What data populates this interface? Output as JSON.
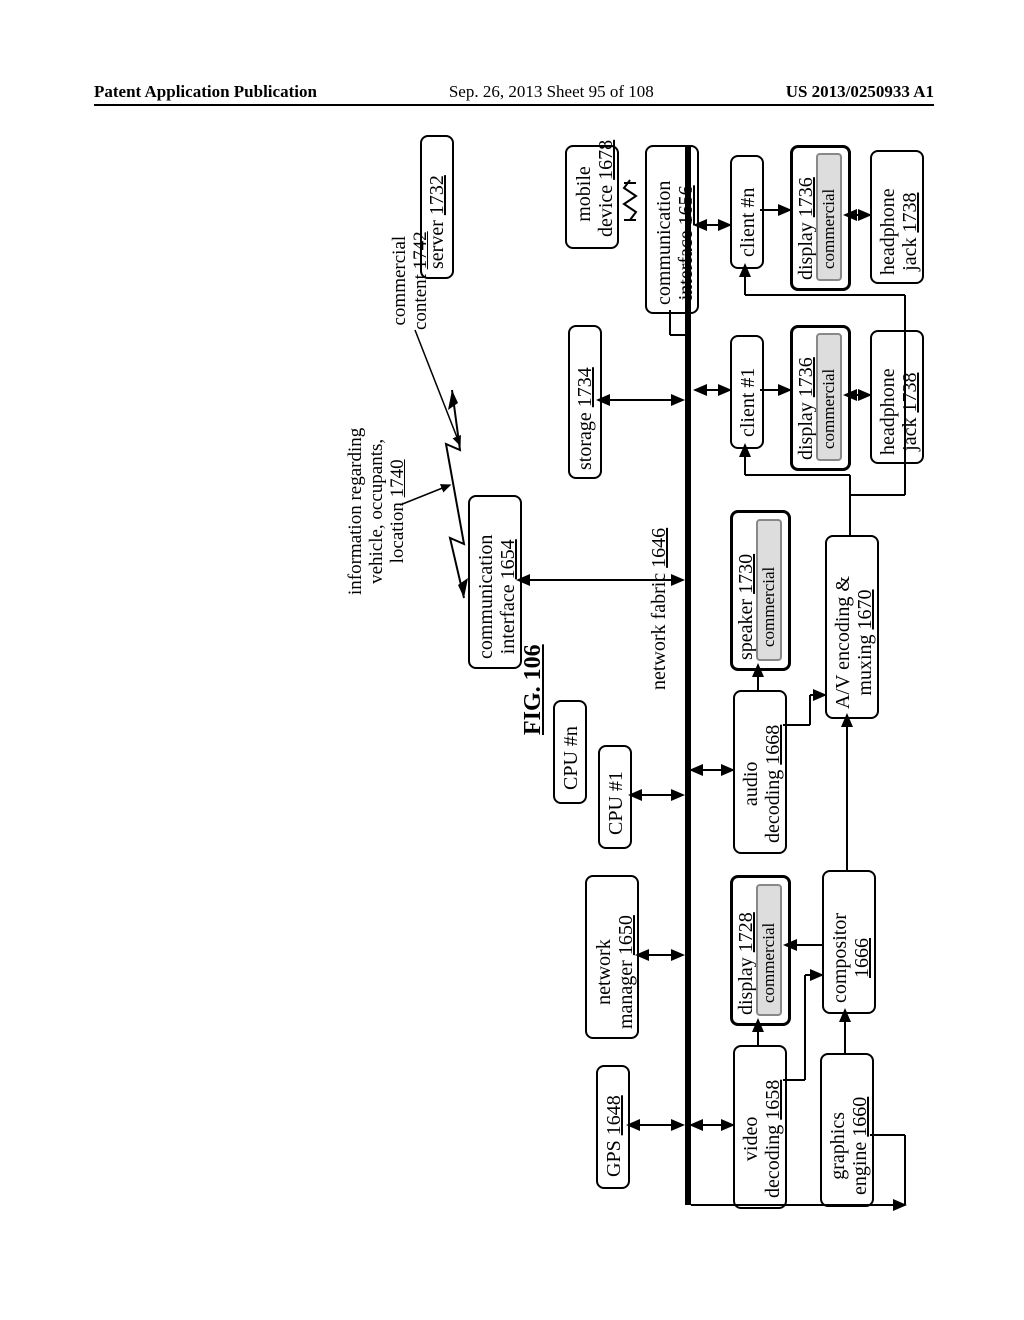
{
  "header": {
    "left": "Patent Application Publication",
    "mid": "Sep. 26, 2013  Sheet 95 of 108",
    "right": "US 2013/0250933 A1"
  },
  "figure": {
    "label": "FIG. 106"
  },
  "blocks": {
    "server": {
      "l1": "server",
      "ref": "1732"
    },
    "info": {
      "l1": "information regarding",
      "l2": "vehicle, occupants,",
      "l3": "location",
      "ref": "1740"
    },
    "commercial_content": {
      "l1": "commercial",
      "l2": "content",
      "ref": "1742"
    },
    "mobile": {
      "l1": "mobile",
      "l2": "device",
      "ref": "1678"
    },
    "comm2": {
      "l1": "communication",
      "l2": "interface",
      "ref": "1656"
    },
    "storage": {
      "l1": "storage",
      "ref": "1734"
    },
    "comm1": {
      "l1": "communication",
      "l2": "interface",
      "ref": "1654"
    },
    "cpun": {
      "l1": "CPU #n"
    },
    "cpu1": {
      "l1": "CPU #1"
    },
    "netmgr": {
      "l1": "network",
      "l2": "manager",
      "ref": "1650"
    },
    "gps": {
      "l1": "GPS",
      "ref": "1648"
    },
    "fabric": {
      "l1": "network fabric",
      "ref": "1646"
    },
    "clientn": {
      "l1": "client #n"
    },
    "client1": {
      "l1": "client #1"
    },
    "display_n": {
      "l1": "display",
      "ref": "1736"
    },
    "display_1": {
      "l1": "display",
      "ref": "1736"
    },
    "hp_n": {
      "l1": "headphone",
      "l2": "jack",
      "ref": "1738"
    },
    "hp_1": {
      "l1": "headphone",
      "l2": "jack",
      "ref": "1738"
    },
    "speaker": {
      "l1": "speaker",
      "ref": "1730"
    },
    "audio": {
      "l1": "audio",
      "l2": "decoding",
      "ref": "1668"
    },
    "avenc": {
      "l1": "A/V encoding &",
      "l2": "muxing",
      "ref": "1670"
    },
    "display_main": {
      "l1": "display",
      "ref": "1728"
    },
    "compositor": {
      "l1": "compositor",
      "ref": "1666"
    },
    "video": {
      "l1": "video",
      "l2": "decoding",
      "ref": "1658"
    },
    "gfx": {
      "l1": "graphics",
      "l2": "engine",
      "ref": "1660"
    },
    "commercial": "commercial"
  }
}
